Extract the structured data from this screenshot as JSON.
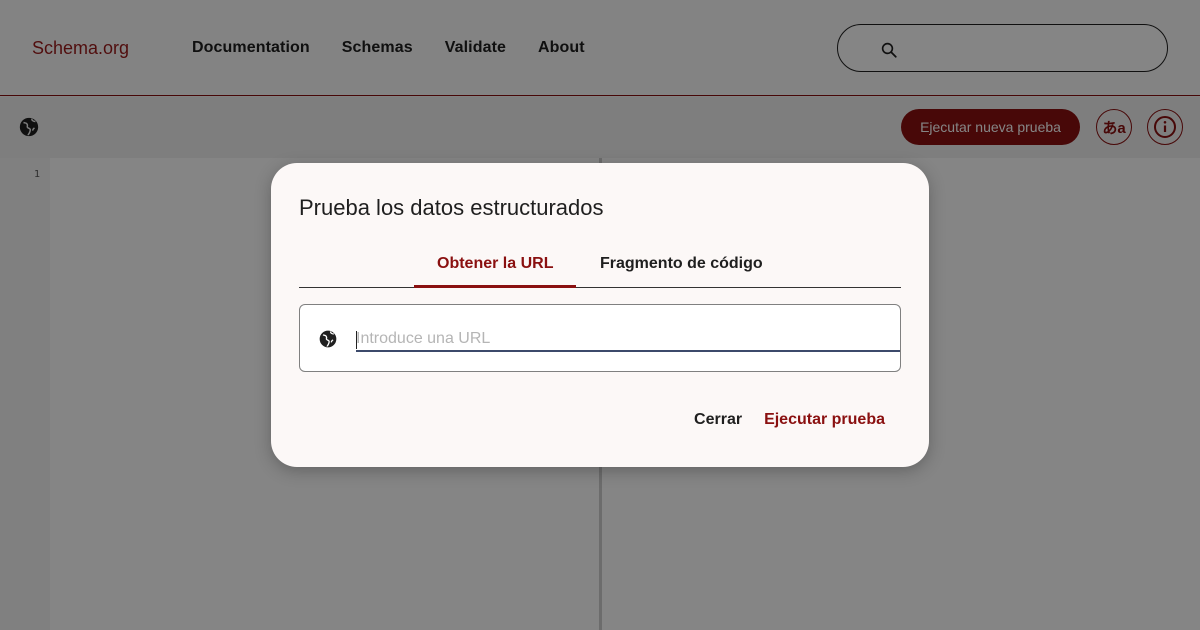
{
  "header": {
    "logo": "Schema.org",
    "nav": [
      "Documentation",
      "Schemas",
      "Validate",
      "About"
    ],
    "search_icon": "search-icon"
  },
  "toolbar": {
    "globe_icon": "globe-icon",
    "run_new_label": "Ejecutar nueva prueba",
    "lang_label": "あa",
    "info_icon": "info-icon"
  },
  "editor": {
    "line_numbers": [
      "1"
    ]
  },
  "dialog": {
    "title": "Prueba los datos estructurados",
    "tabs": [
      {
        "label": "Obtener la URL",
        "active": true
      },
      {
        "label": "Fragmento de código",
        "active": false
      }
    ],
    "url_placeholder": "Introduce una URL",
    "url_value": "",
    "close_label": "Cerrar",
    "run_label": "Ejecutar prueba"
  },
  "colors": {
    "accent": "#8a1010",
    "logo": "#9b1c1c",
    "overlay": "rgba(0,0,0,0.48)"
  }
}
